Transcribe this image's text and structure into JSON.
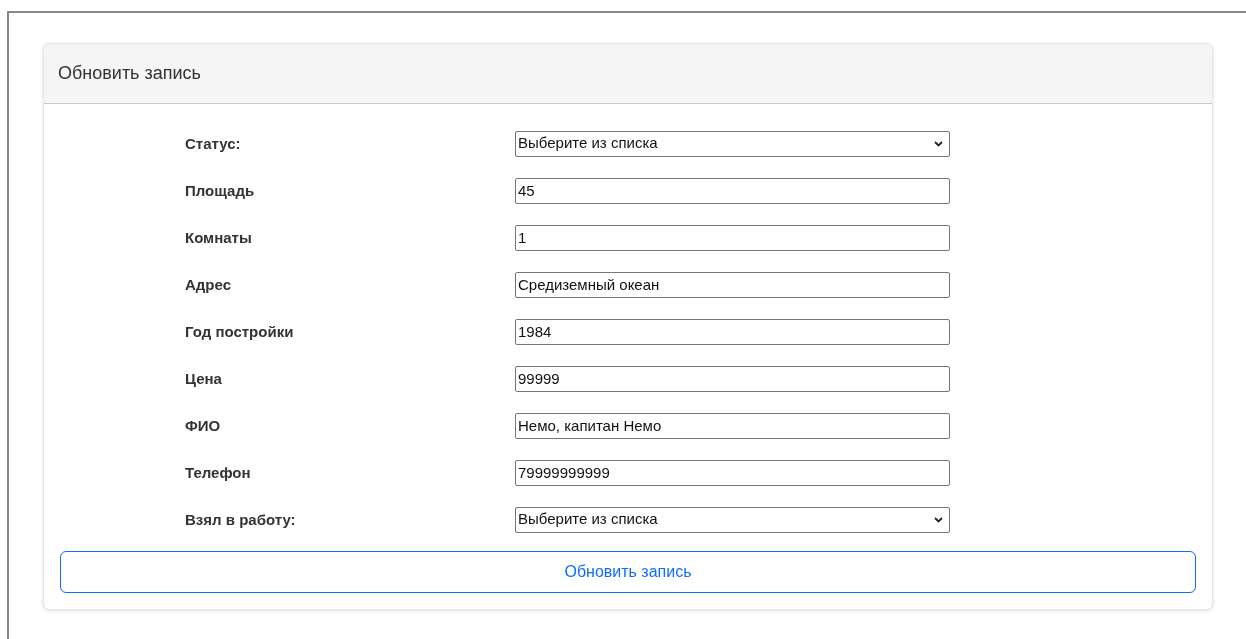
{
  "card": {
    "title": "Обновить запись"
  },
  "fields": [
    {
      "label": "Статус:",
      "kind": "select",
      "value": "Выберите из списка"
    },
    {
      "label": "Площадь",
      "kind": "input",
      "value": "45"
    },
    {
      "label": "Комнаты",
      "kind": "input",
      "value": "1"
    },
    {
      "label": "Адрес",
      "kind": "input",
      "value": "Средиземный океан"
    },
    {
      "label": "Год постройки",
      "kind": "input",
      "value": "1984"
    },
    {
      "label": "Цена",
      "kind": "input",
      "value": "99999"
    },
    {
      "label": "ФИО",
      "kind": "input",
      "value": "Немо, капитан Немо"
    },
    {
      "label": "Телефон",
      "kind": "input",
      "value": "79999999999"
    },
    {
      "label": "Взял в работу:",
      "kind": "select",
      "value": "Выберите из списка"
    }
  ],
  "submit": {
    "label": "Обновить запись"
  }
}
